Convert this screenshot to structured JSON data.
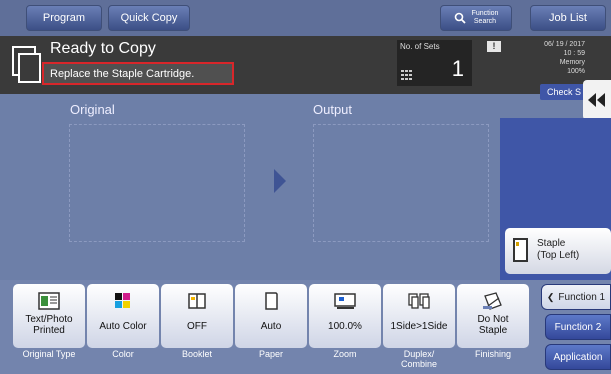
{
  "topbar": {
    "program": "Program",
    "quick_copy": "Quick Copy",
    "function_search_line1": "Function",
    "function_search_line2": "Search",
    "job_list": "Job List"
  },
  "status": {
    "title": "Ready to Copy",
    "message": "Replace the Staple Cartridge.",
    "sets_label": "No. of Sets",
    "sets_value": "1",
    "warning": "!",
    "date": "06/ 19 / 2017",
    "time": "10 : 59",
    "memory_label": "Memory",
    "memory_value": "100%",
    "check_settings": "Check S"
  },
  "preview": {
    "original_label": "Original",
    "output_label": "Output"
  },
  "staple": {
    "line1": "Staple",
    "line2": "(Top Left)"
  },
  "functions": [
    {
      "value_line1": "Text/Photo",
      "value_line2": "Printed",
      "label": "Original Type",
      "icon": "original-type-icon"
    },
    {
      "value_line1": "Auto Color",
      "value_line2": "",
      "label": "Color",
      "icon": "color-icon"
    },
    {
      "value_line1": "OFF",
      "value_line2": "",
      "label": "Booklet",
      "icon": "booklet-icon"
    },
    {
      "value_line1": "Auto",
      "value_line2": "",
      "label": "Paper",
      "icon": "paper-icon"
    },
    {
      "value_line1": "100.0%",
      "value_line2": "",
      "label": "Zoom",
      "icon": "zoom-icon"
    },
    {
      "value_line1": "1Side>1Side",
      "value_line2": "",
      "label_line1": "Duplex/",
      "label_line2": "Combine",
      "icon": "duplex-icon"
    },
    {
      "value_line1": "Do Not",
      "value_line2": "Staple",
      "label": "Finishing",
      "icon": "finishing-icon"
    }
  ],
  "side": {
    "function1": "Function 1",
    "function2": "Function 2",
    "application": "Application"
  },
  "colors": {
    "background": "#6d7fa8",
    "status_panel": "#3a3a3a",
    "alert_border": "#d8262a",
    "accent_blue": "#3f56a7"
  }
}
